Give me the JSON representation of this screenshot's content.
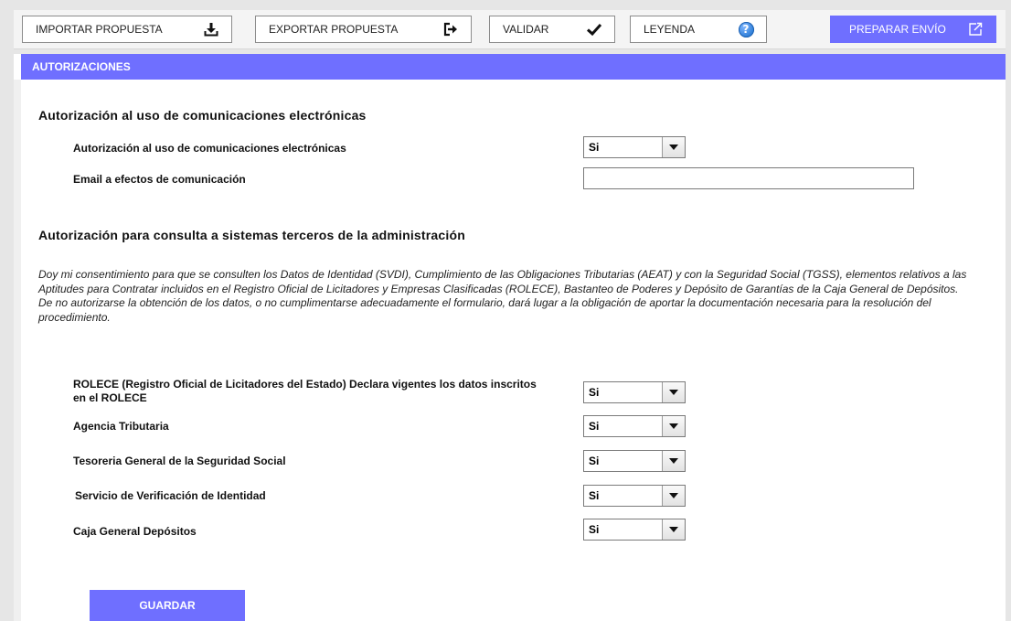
{
  "toolbar": {
    "import_label": "IMPORTAR PROPUESTA",
    "export_label": "EXPORTAR PROPUESTA",
    "validate_label": "VALIDAR",
    "legend_label": "LEYENDA",
    "legend_icon_text": "?",
    "prepare_label": "PREPARAR ENVÍO"
  },
  "colors": {
    "accent": "#6f6fff",
    "help_icon": "#2f7fd8"
  },
  "icons": {
    "import": "download-icon",
    "export": "exit-arrow-icon",
    "validate": "checkmark-icon",
    "legend": "help-circle-icon",
    "prepare": "share-export-icon"
  },
  "panel": {
    "title": "AUTORIZACIONES"
  },
  "section1": {
    "title": "Autorización al uso de comunicaciones electrónicas",
    "rows": [
      {
        "label": "Autorización al uso de comunicaciones electrónicas",
        "value": "Si"
      }
    ],
    "email_label": "Email a efectos de comunicación",
    "email_value": ""
  },
  "section2": {
    "title": "Autorización para consulta a sistemas terceros de la administración",
    "consent_p1": "Doy mi consentimiento para que se consulten los Datos de Identidad (SVDI), Cumplimiento de las Obligaciones Tributarias (AEAT) y con la Seguridad Social (TGSS), elementos relativos a las Aptitudes para Contratar incluidos en el Registro Oficial de Licitadores y Empresas Clasificadas (ROLECE), Bastanteo de Poderes y Depósito de Garantías de la Caja General de Depósitos.",
    "consent_p2": "De no autorizarse la obtención de los datos, o no cumplimentarse adecuadamente el formulario, dará lugar a la obligación de aportar la documentación necesaria para la resolución del procedimiento.",
    "rows": [
      {
        "label": "ROLECE (Registro Oficial de Licitadores del Estado) Declara vigentes los datos inscritos en el ROLECE",
        "value": "Si"
      },
      {
        "label": "Agencia Tributaria",
        "value": "Si"
      },
      {
        "label": "Tesoreria General de la Seguridad Social",
        "value": "Si"
      },
      {
        "label": "Servicio de Verificación de Identidad",
        "value": "Si"
      },
      {
        "label": "Caja General Depósitos",
        "value": "Si"
      }
    ]
  },
  "save_label": "GUARDAR"
}
